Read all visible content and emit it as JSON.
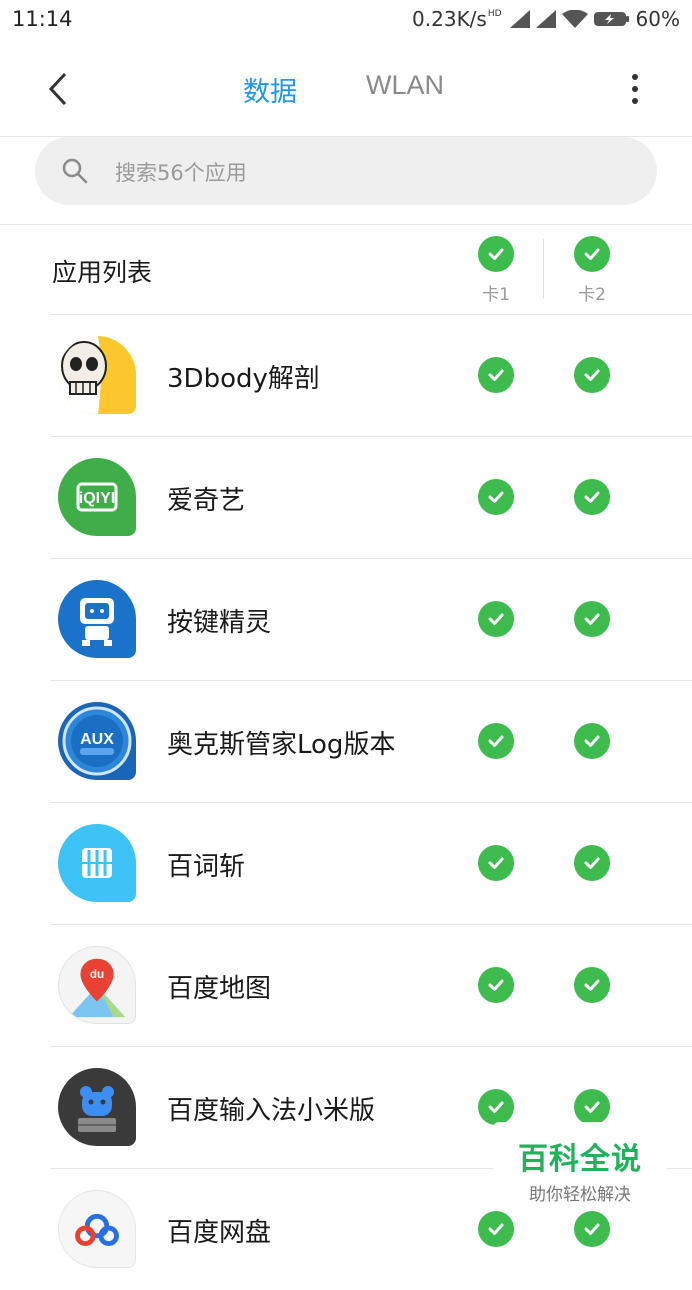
{
  "status_bar": {
    "time": "11:14",
    "net_speed": "0.23K/s",
    "hd_label": "HD",
    "battery": "60%",
    "signal_icon": "signal-icon",
    "wifi_icon": "wifi-icon",
    "battery_icon": "battery-charging-icon"
  },
  "nav": {
    "back_icon": "chevron-left-icon",
    "tabs": [
      {
        "label": "数据",
        "active": true
      },
      {
        "label": "WLAN",
        "active": false
      }
    ],
    "more_icon": "more-vertical-icon",
    "active_color": "#2196f3"
  },
  "search": {
    "placeholder": "搜索56个应用",
    "icon": "search-icon"
  },
  "list": {
    "title": "应用列表",
    "columns": [
      {
        "label": "卡1",
        "checked": true
      },
      {
        "label": "卡2",
        "checked": true
      }
    ],
    "check_color": "#3dbb4c",
    "apps": [
      {
        "name": "3Dbody解剖",
        "icon": "skull-app-icon",
        "sim1": true,
        "sim2": true
      },
      {
        "name": "爱奇艺",
        "icon": "iqiyi-app-icon",
        "sim1": true,
        "sim2": true
      },
      {
        "name": "按键精灵",
        "icon": "robot-app-icon",
        "sim1": true,
        "sim2": true
      },
      {
        "name": "奥克斯管家Log版本",
        "icon": "aux-app-icon",
        "sim1": true,
        "sim2": true
      },
      {
        "name": "百词斩",
        "icon": "baicizhan-app-icon",
        "sim1": true,
        "sim2": true
      },
      {
        "name": "百度地图",
        "icon": "baidu-map-app-icon",
        "sim1": true,
        "sim2": true
      },
      {
        "name": "百度输入法小米版",
        "icon": "baidu-input-app-icon",
        "sim1": true,
        "sim2": true
      },
      {
        "name": "百度网盘",
        "icon": "baidu-netdisk-app-icon",
        "sim1": true,
        "sim2": true
      }
    ]
  },
  "watermark": {
    "brand": "百科全说",
    "slogan": "助你轻松解决"
  }
}
